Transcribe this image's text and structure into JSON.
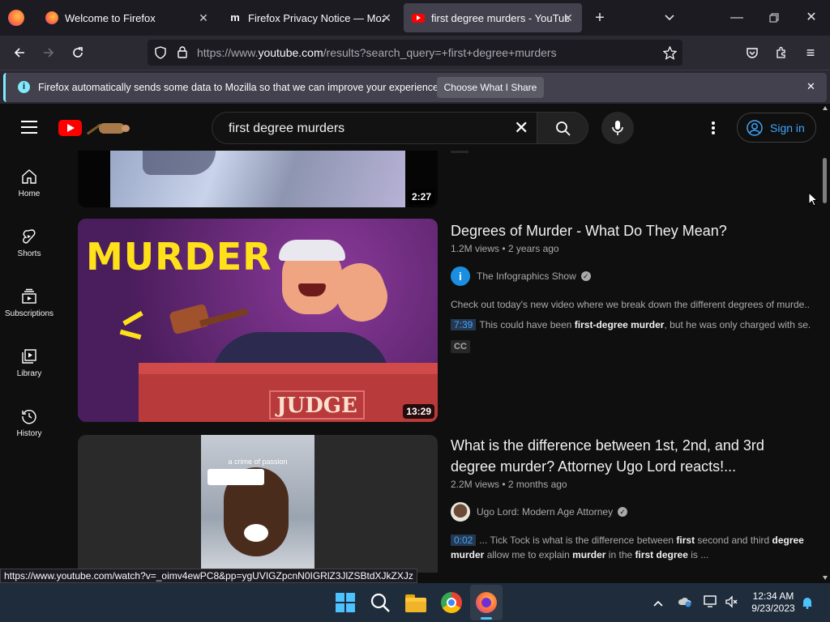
{
  "browser": {
    "tabs": [
      {
        "title": "Welcome to Firefox"
      },
      {
        "title": "Firefox Privacy Notice — Mozill"
      },
      {
        "title": "first degree murders - YouTube"
      }
    ],
    "url_prefix": "https://www.",
    "url_domain": "youtube.com",
    "url_rest": "/results?search_query=+first+degree+murders",
    "notification_text": "Firefox automatically sends some data to Mozilla so that we can improve your experience.",
    "notification_button": "Choose What I Share",
    "status_url": "https://www.youtube.com/watch?v=_oimv4ewPC8&pp=ygUVIGZpcnN0IGRlZ3JlZSBtdXJkZXJz"
  },
  "youtube": {
    "search_value": "first degree murders",
    "sign_in": "Sign in",
    "sidebar": [
      {
        "label": "Home"
      },
      {
        "label": "Shorts"
      },
      {
        "label": "Subscriptions"
      },
      {
        "label": "Library"
      },
      {
        "label": "History"
      }
    ],
    "results": [
      {
        "duration": "2:27"
      },
      {
        "title": "Degrees of Murder - What Do They Mean?",
        "meta": "1.2M views • 2 years ago",
        "channel": "The Infographics Show",
        "description": "Check out today's new video where we break down the different degrees of murde...",
        "chapter_time": "7:39",
        "chapter_text_pre": "This could have been ",
        "chapter_text_bold": "first-degree murder",
        "chapter_text_post": ", but he was only charged with se...",
        "badge": "CC",
        "duration": "13:29",
        "thumb_text_top": "MURDER",
        "thumb_text_bottom": "JUDGE"
      },
      {
        "title": "What is the difference between 1st, 2nd, and 3rd degree murder? Attorney Ugo Lord reacts!...",
        "meta": "2.2M views • 2 months ago",
        "channel": "Ugo Lord: Modern Age Attorney",
        "chapter_time": "0:02",
        "line1": "... Tick Tock is what is the difference between first second and third degree",
        "line2": "murder allow me to explain murder in the first degree is ...",
        "thumb_caption": "a crime of passion"
      }
    ]
  },
  "taskbar": {
    "time": "12:34 AM",
    "date": "9/23/2023"
  }
}
